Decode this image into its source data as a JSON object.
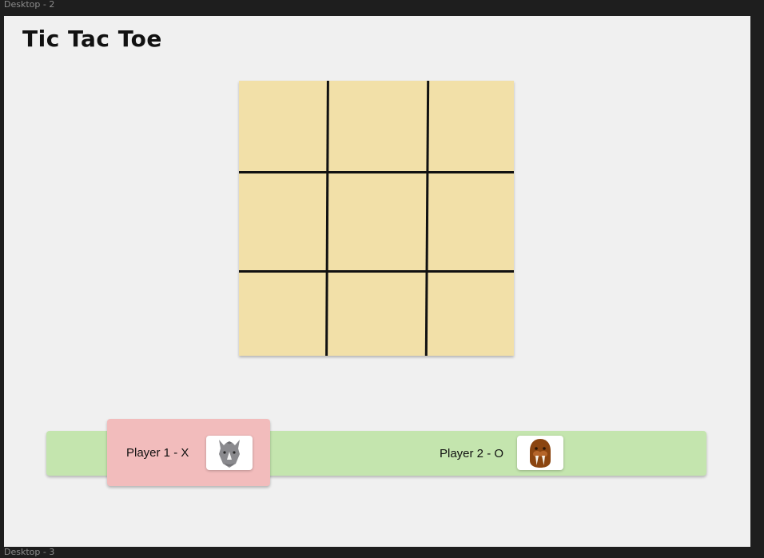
{
  "frame_labels": {
    "top": "Desktop - 2",
    "bottom": "Desktop - 3"
  },
  "app": {
    "title": "Tic Tac Toe"
  },
  "board": {
    "cells": [
      "",
      "",
      "",
      "",
      "",
      "",
      "",
      "",
      ""
    ],
    "color": "#f2e0a8"
  },
  "players": [
    {
      "label": "Player 1 - X",
      "avatar": "rhino-icon",
      "active": true,
      "color": "#f2bcbc"
    },
    {
      "label": "Player 2 - O",
      "avatar": "walrus-icon",
      "active": false
    }
  ],
  "colors": {
    "bar": "#c4e5ae",
    "canvas": "#f0f0f0"
  }
}
